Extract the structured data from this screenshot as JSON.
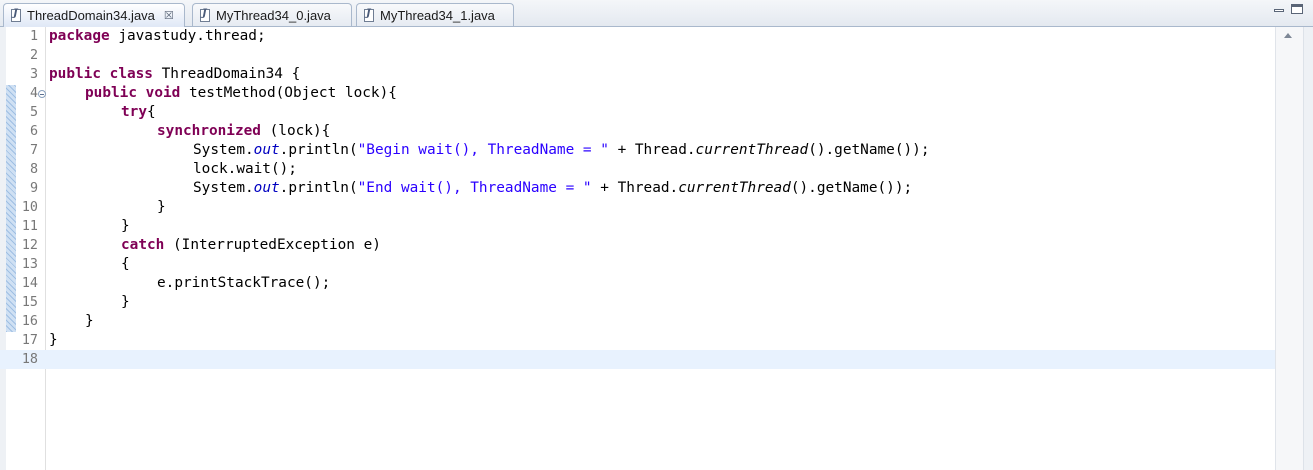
{
  "tabs": [
    {
      "label": "ThreadDomain34.java",
      "active": true,
      "icon": "java-file-icon",
      "close": "☒"
    },
    {
      "label": "MyThread34_0.java",
      "active": false,
      "icon": "java-file-icon"
    },
    {
      "label": "MyThread34_1.java",
      "active": false,
      "icon": "java-file-icon"
    }
  ],
  "editor": {
    "current_line": 18,
    "lines": [
      {
        "n": "1",
        "tokens": [
          [
            "kw",
            "package"
          ],
          [
            "",
            "javastudy.thread;"
          ]
        ]
      },
      {
        "n": "2",
        "tokens": []
      },
      {
        "n": "3",
        "tokens": [
          [
            "kw",
            "public"
          ],
          [
            "",
            " "
          ],
          [
            "kw",
            "class"
          ],
          [
            "",
            " ThreadDomain34 {"
          ]
        ]
      },
      {
        "n": "4",
        "fold": true,
        "tokens": [
          [
            "",
            " "
          ],
          [
            "kw",
            "public"
          ],
          [
            "",
            " "
          ],
          [
            "kw",
            "void"
          ],
          [
            "",
            " testMethod(Object lock){"
          ]
        ]
      },
      {
        "n": "5",
        "tokens": [
          [
            "",
            " "
          ],
          [
            "kw",
            "try"
          ],
          [
            "",
            "{"
          ]
        ]
      },
      {
        "n": "6",
        "tokens": [
          [
            "",
            " "
          ],
          [
            "kw",
            "synchronized"
          ],
          [
            "",
            " (lock){"
          ]
        ]
      },
      {
        "n": "7",
        "tokens": [
          [
            "",
            " System."
          ],
          [
            "fld",
            "out"
          ],
          [
            "",
            ".println("
          ],
          [
            "str",
            "\"Begin wait(), ThreadName = \""
          ],
          [
            "",
            " + Thread."
          ],
          [
            "ita",
            "currentThread"
          ],
          [
            "",
            "().getName());"
          ]
        ]
      },
      {
        "n": "8",
        "tokens": [
          [
            "",
            " lock.wait();"
          ]
        ]
      },
      {
        "n": "9",
        "tokens": [
          [
            "",
            " System."
          ],
          [
            "fld",
            "out"
          ],
          [
            "",
            ".println("
          ],
          [
            "str",
            "\"End wait(), ThreadName = \""
          ],
          [
            "",
            " + Thread."
          ],
          [
            "ita",
            "currentThread"
          ],
          [
            "",
            "().getName());"
          ]
        ]
      },
      {
        "n": "10",
        "tokens": [
          [
            "",
            " }"
          ]
        ]
      },
      {
        "n": "11",
        "tokens": [
          [
            "",
            " }"
          ]
        ]
      },
      {
        "n": "12",
        "tokens": [
          [
            "",
            " "
          ],
          [
            "kw",
            "catch"
          ],
          [
            "",
            " (InterruptedException e)"
          ]
        ]
      },
      {
        "n": "13",
        "tokens": [
          [
            "",
            " {"
          ]
        ]
      },
      {
        "n": "14",
        "tokens": [
          [
            "",
            " e.printStackTrace();"
          ]
        ]
      },
      {
        "n": "15",
        "tokens": [
          [
            "",
            " }"
          ]
        ]
      },
      {
        "n": "16",
        "tokens": [
          [
            "",
            " }"
          ]
        ]
      },
      {
        "n": "17",
        "tokens": [
          [
            "",
            "}"
          ]
        ]
      },
      {
        "n": "18",
        "tokens": []
      }
    ]
  },
  "colors": {
    "keyword": "#7f0055",
    "string": "#2a00ff",
    "field": "#0000c0",
    "current_line_bg": "#e8f2fe",
    "line_number": "#787878"
  }
}
